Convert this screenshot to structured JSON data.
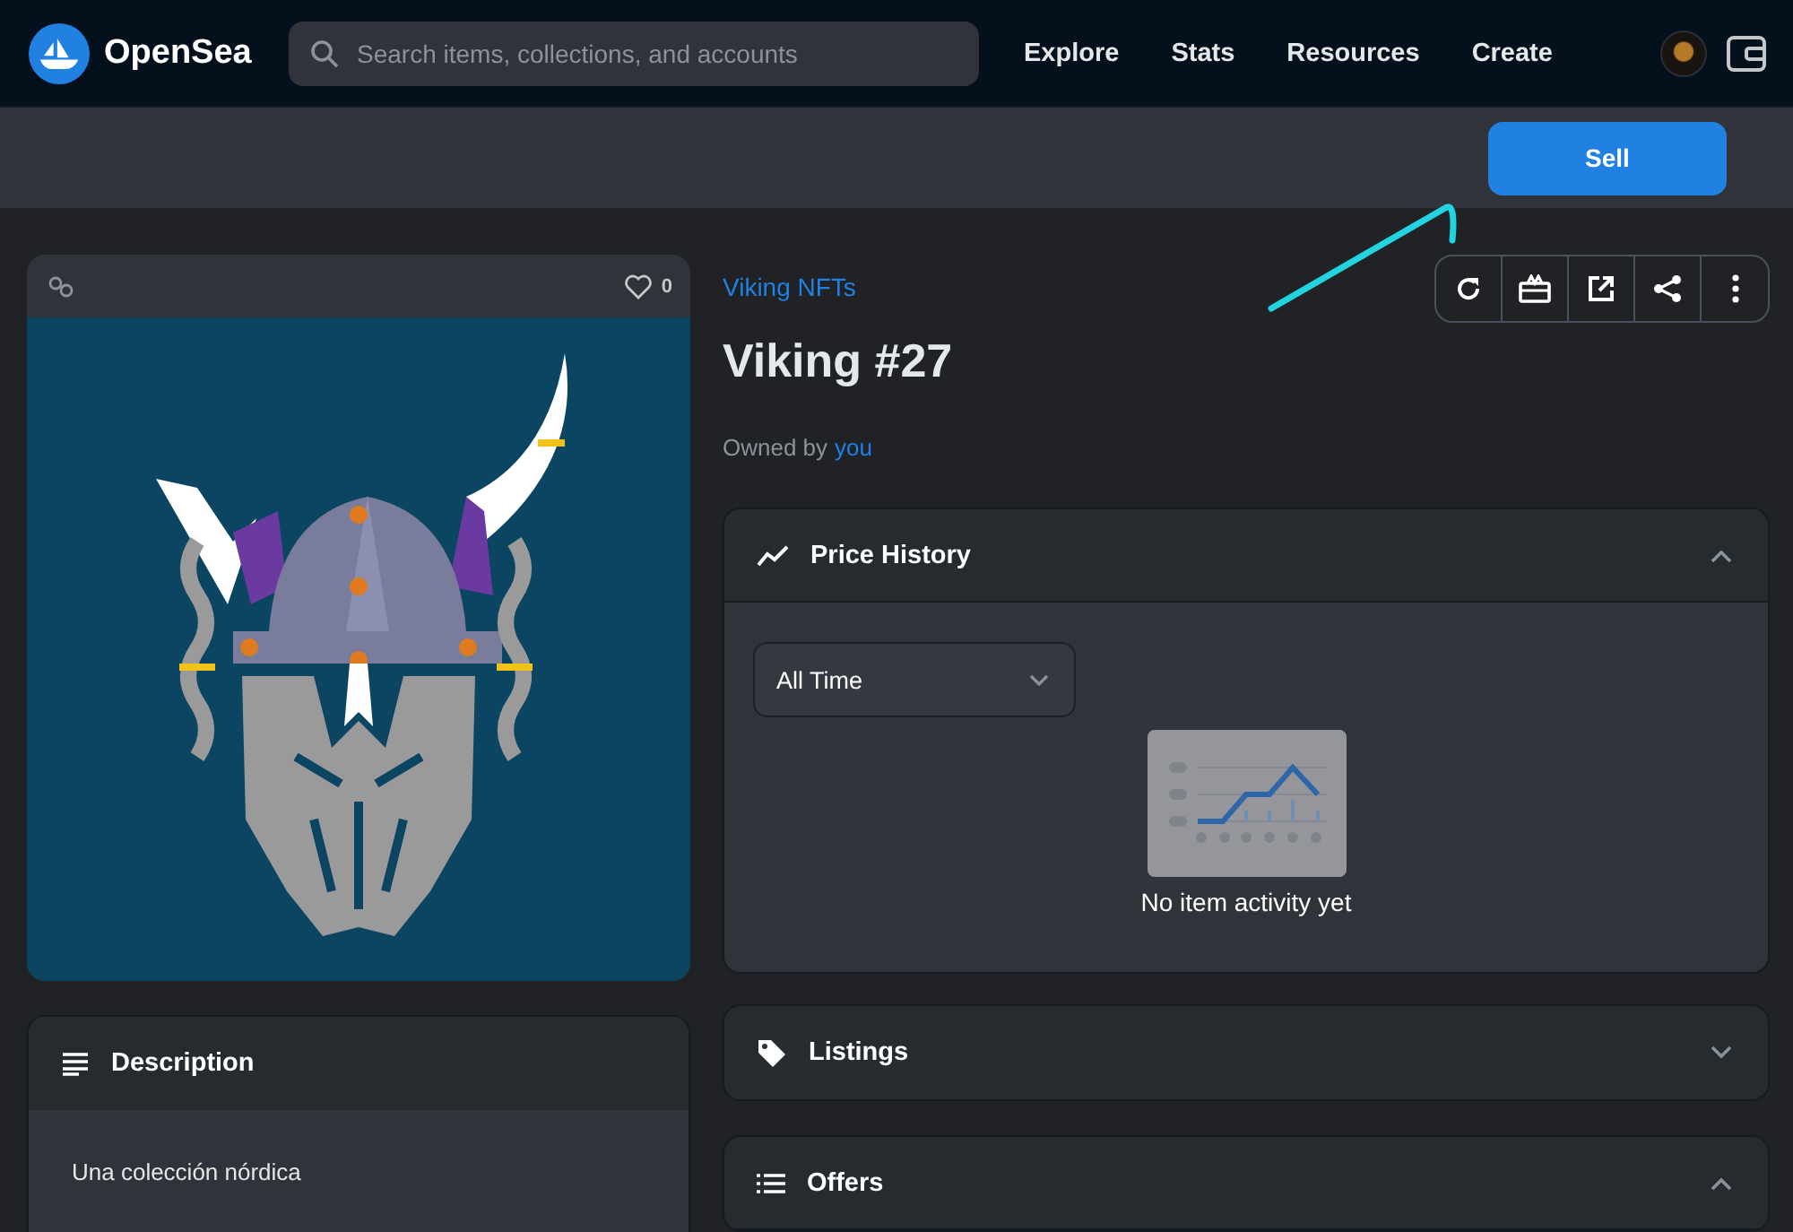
{
  "nav": {
    "logo": "OpenSea",
    "search_placeholder": "Search items, collections, and accounts",
    "links": [
      "Explore",
      "Stats",
      "Resources",
      "Create"
    ]
  },
  "sell_button": "Sell",
  "item": {
    "likes": "0",
    "collection": "Viking NFTs",
    "title": "Viking #27",
    "owner_prefix": "Owned by",
    "owner": "you"
  },
  "description": {
    "title": "Description",
    "text": "Una colección nórdica"
  },
  "panels": [
    {
      "kind": "price_history",
      "title": "Price History",
      "expanded": true,
      "filter": "All Time",
      "empty_text": "No item activity yet"
    },
    {
      "kind": "listings",
      "title": "Listings",
      "expanded": false
    },
    {
      "kind": "offers",
      "title": "Offers",
      "expanded": true
    }
  ]
}
